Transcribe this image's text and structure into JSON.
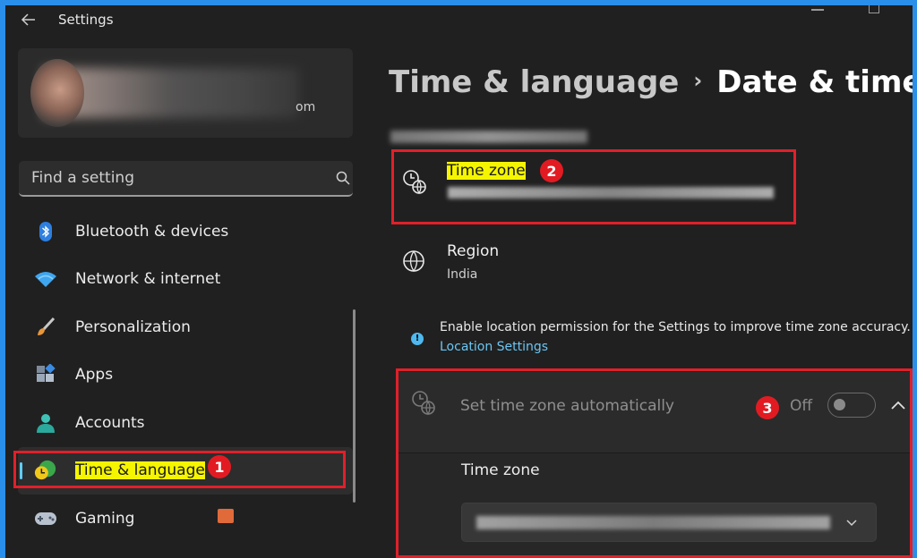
{
  "window": {
    "title": "Settings"
  },
  "profile": {
    "email_visible_tail": "om"
  },
  "search": {
    "placeholder": "Find a setting"
  },
  "sidebar": {
    "items": [
      {
        "label": "Bluetooth & devices",
        "icon": "bluetooth-icon"
      },
      {
        "label": "Network & internet",
        "icon": "wifi-icon"
      },
      {
        "label": "Personalization",
        "icon": "paintbrush-icon"
      },
      {
        "label": "Apps",
        "icon": "apps-icon"
      },
      {
        "label": "Accounts",
        "icon": "person-icon"
      },
      {
        "label": "Time & language",
        "icon": "clock-globe-icon",
        "active": true
      },
      {
        "label": "Gaming",
        "icon": "gamepad-icon"
      }
    ]
  },
  "header": {
    "parent": "Time & language",
    "separator": "›",
    "current": "Date & time"
  },
  "timezone_row": {
    "title": "Time zone"
  },
  "region_row": {
    "title": "Region",
    "value": "India"
  },
  "location_info": {
    "text": "Enable location permission for the Settings to improve time zone accuracy.",
    "link": "Location Settings"
  },
  "auto_timezone": {
    "label": "Set time zone automatically",
    "state": "Off"
  },
  "timezone_dropdown": {
    "label": "Time zone"
  },
  "annotations": {
    "badge_1": "1",
    "badge_2": "2",
    "badge_3": "3",
    "color": "#e0202a"
  },
  "colors": {
    "accent": "#60cdff",
    "link": "#6cc5f0",
    "highlight": "#ffff00"
  }
}
